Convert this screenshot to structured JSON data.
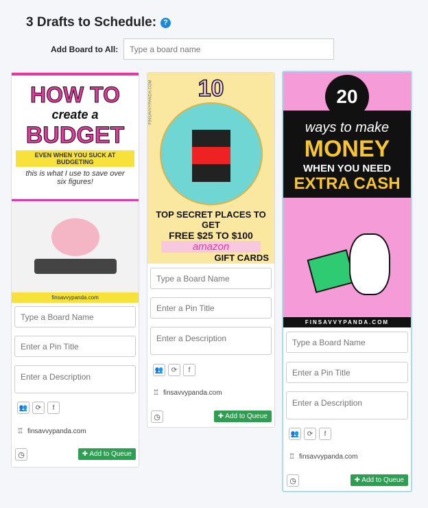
{
  "header": {
    "title": "3 Drafts to Schedule:",
    "help_icon": "question-circle-icon",
    "add_board_label": "Add Board to All:",
    "add_board_placeholder": "Type a board name"
  },
  "colors": {
    "accent": "#1e88d6",
    "queue_button": "#2e9f52",
    "selected_border": "#a8dcf0"
  },
  "pins": [
    {
      "image_text": [
        "HOW TO",
        "create a",
        "BUDGET",
        "EVEN WHEN YOU SUCK AT BUDGETING",
        "this is what I use to save over six figures!",
        "finsavvypanda.com"
      ],
      "board_placeholder": "Type a Board Name",
      "title_placeholder": "Enter a Pin Title",
      "description_placeholder": "Enter a Description",
      "site": "finsavvypanda.com",
      "queue_label": "Add to Queue"
    },
    {
      "image_text": [
        "10",
        "TOP SECRET PLACES TO GET",
        "FREE $25 TO $100",
        "amazon",
        "GIFT CARDS",
        "FINSAVVYPANDA.COM"
      ],
      "board_placeholder": "Type a Board Name",
      "title_placeholder": "Enter a Pin Title",
      "description_placeholder": "Enter a Description",
      "site": "finsavvypanda.com",
      "queue_label": "Add to Queue"
    },
    {
      "image_text": [
        "20",
        "ways to make",
        "MONEY",
        "WHEN YOU NEED",
        "EXTRA CASH",
        "FINSAVVYPANDA.COM"
      ],
      "board_placeholder": "Type a Board Name",
      "title_placeholder": "Enter a Pin Title",
      "description_placeholder": "Enter a Description",
      "site": "finsavvypanda.com",
      "queue_label": "Add to Queue"
    }
  ]
}
